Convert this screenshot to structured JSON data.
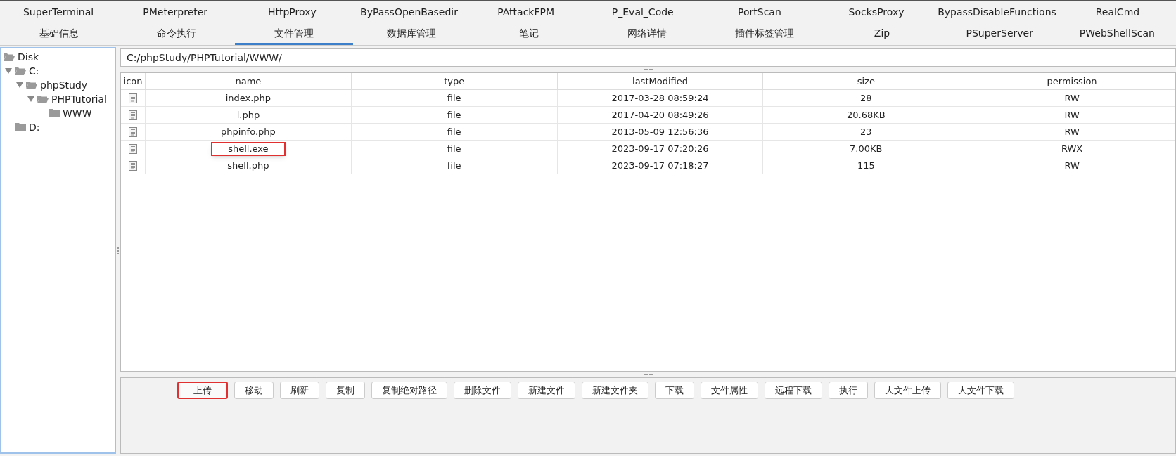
{
  "plugin_tabs": [
    {
      "label": "SuperTerminal"
    },
    {
      "label": "PMeterpreter"
    },
    {
      "label": "HttpProxy"
    },
    {
      "label": "ByPassOpenBasedir"
    },
    {
      "label": "PAttackFPM"
    },
    {
      "label": "P_Eval_Code"
    },
    {
      "label": "PortScan"
    },
    {
      "label": "SocksProxy"
    },
    {
      "label": "BypassDisableFunctions"
    },
    {
      "label": "RealCmd"
    }
  ],
  "main_tabs": [
    {
      "label": "基础信息",
      "selected": false
    },
    {
      "label": "命令执行",
      "selected": false
    },
    {
      "label": "文件管理",
      "selected": true
    },
    {
      "label": "数据库管理",
      "selected": false
    },
    {
      "label": "笔记",
      "selected": false
    },
    {
      "label": "网络详情",
      "selected": false
    },
    {
      "label": "插件标签管理",
      "selected": false
    },
    {
      "label": "Zip",
      "selected": false
    },
    {
      "label": "PSuperServer",
      "selected": false
    },
    {
      "label": "PWebShellScan",
      "selected": false
    }
  ],
  "tree": [
    {
      "label": "Disk",
      "expanded": true,
      "children": [
        {
          "label": "C:",
          "expanded": true,
          "children": [
            {
              "label": "phpStudy",
              "expanded": true,
              "children": [
                {
                  "label": "PHPTutorial",
                  "expanded": true,
                  "children": [
                    {
                      "label": "WWW"
                    }
                  ]
                }
              ]
            }
          ]
        },
        {
          "label": "D:"
        }
      ]
    }
  ],
  "path": "C:/phpStudy/PHPTutorial/WWW/",
  "table": {
    "columns": [
      "icon",
      "name",
      "type",
      "lastModified",
      "size",
      "permission"
    ],
    "rows": [
      {
        "name": "index.php",
        "type": "file",
        "lastModified": "2017-03-28 08:59:24",
        "size": "28",
        "permission": "RW",
        "highlighted": false
      },
      {
        "name": "l.php",
        "type": "file",
        "lastModified": "2017-04-20 08:49:26",
        "size": "20.68KB",
        "permission": "RW",
        "highlighted": false
      },
      {
        "name": "phpinfo.php",
        "type": "file",
        "lastModified": "2013-05-09 12:56:36",
        "size": "23",
        "permission": "RW",
        "highlighted": false
      },
      {
        "name": "shell.exe",
        "type": "file",
        "lastModified": "2023-09-17 07:20:26",
        "size": "7.00KB",
        "permission": "RWX",
        "highlighted": true
      },
      {
        "name": "shell.php",
        "type": "file",
        "lastModified": "2023-09-17 07:18:27",
        "size": "115",
        "permission": "RW",
        "highlighted": false
      }
    ]
  },
  "buttons": [
    {
      "label": "上传",
      "highlighted": true
    },
    {
      "label": "移动",
      "highlighted": false
    },
    {
      "label": "刷新",
      "highlighted": false
    },
    {
      "label": "复制",
      "highlighted": false
    },
    {
      "label": "复制绝对路径",
      "highlighted": false
    },
    {
      "label": "删除文件",
      "highlighted": false
    },
    {
      "label": "新建文件",
      "highlighted": false
    },
    {
      "label": "新建文件夹",
      "highlighted": false
    },
    {
      "label": "下载",
      "highlighted": false
    },
    {
      "label": "文件属性",
      "highlighted": false
    },
    {
      "label": "远程下载",
      "highlighted": false
    },
    {
      "label": "执行",
      "highlighted": false
    },
    {
      "label": "大文件上传",
      "highlighted": false
    },
    {
      "label": "大文件下载",
      "highlighted": false
    }
  ]
}
